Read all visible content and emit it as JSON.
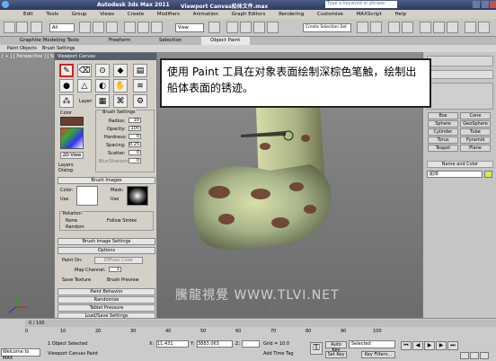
{
  "app": {
    "title": "Autodesk 3ds Max  2011",
    "file_title": "Viewport Canvas船体文件.max",
    "search_placeholder": "Type a keyword or phrase"
  },
  "menu": [
    "Edit",
    "Tools",
    "Group",
    "Views",
    "Create",
    "Modifiers",
    "Animation",
    "Graph Editors",
    "Rendering",
    "Customize",
    "MAXScript",
    "Help"
  ],
  "toolbar": {
    "filter": "All",
    "viewport_type": "View",
    "selection_set": "Create Selection Set"
  },
  "ribbon": {
    "tabs": [
      "Graphite Modeling Tools",
      "Freeform",
      "Selection",
      "Object Paint"
    ],
    "subtabs": [
      "Paint Objects",
      "Brush Settings"
    ]
  },
  "viewport": {
    "label": "[ + ] [ Perspective ] [ Smooth + Highlights ]"
  },
  "canvas_panel": {
    "title": "Viewport Canvas",
    "layer_label": "Layer:",
    "color_label": "Color",
    "view_2d": "2D View",
    "layers_dialog": "Layers Dialog",
    "brush_settings": {
      "heading": "Brush Settings",
      "radius_label": "Radius:",
      "radius": "10",
      "opacity_label": "Opacity:",
      "opacity": "100",
      "hardness_label": "Hardness:",
      "hardness": "0",
      "spacing_label": "Spacing:",
      "spacing": "0.25",
      "scatter_label": "Scatter:",
      "scatter": "0",
      "blur_label": "Blur/Sharpen:",
      "blur": "0"
    },
    "brush_images": {
      "heading": "Brush Images",
      "color_label": "Color:",
      "mask_label": "Mask:",
      "use1": "Use",
      "use2": "Use"
    },
    "rotation": {
      "label": "Rotation",
      "none": "None",
      "random": "Random",
      "follow": "Follow Stroke"
    },
    "rollouts": [
      "Brush Image Settings",
      "Options"
    ],
    "options": {
      "paint_on": "Paint On:",
      "diffuse": "Diffuse Color",
      "map_channel_label": "Map Channel:",
      "map_channel": "1",
      "save_texture": "Save Texture",
      "brush_preview": "Brush Preview"
    },
    "bottom_rollouts": [
      "Paint Behavior",
      "Randomize",
      "Tablet Pressure",
      "Load/Save Settings"
    ]
  },
  "instruction_text": "使用 Paint 工具在对象表面绘制深棕色笔触，绘制出船体表面的锈迹。",
  "command_panel": {
    "rollout_label": "Name and Color",
    "object_buttons": [
      "Box",
      "Cone",
      "Sphere",
      "GeoSphere",
      "Cylinder",
      "Tube",
      "Torus",
      "Pyramid",
      "Teapot",
      "Plane"
    ],
    "object_name": "船体"
  },
  "watermark": "騰龍視覺 WWW.TLVI.NET",
  "status": {
    "frame": "0 / 100",
    "welcome": "Welcome to MAX",
    "selected": "1 Object Selected",
    "tool": "Viewport Canvas Paint",
    "x_label": "X:",
    "x": "11.431",
    "y_label": "Y:",
    "y": "3883.063",
    "z_label": "Z:",
    "z": "",
    "grid": "Grid = 10.0",
    "add_time_tag": "Add Time Tag",
    "auto_key": "Auto Key",
    "set_key": "Set Key",
    "selected_dropdown": "Selected",
    "key_filters": "Key Filters...",
    "ticks": [
      "0",
      "10",
      "20",
      "30",
      "40",
      "50",
      "60",
      "70",
      "80",
      "90",
      "100"
    ]
  },
  "colors": {
    "brown_stroke": "#6b3d2d",
    "tooltip_border": "#222222",
    "red_highlight": "#d62020"
  }
}
